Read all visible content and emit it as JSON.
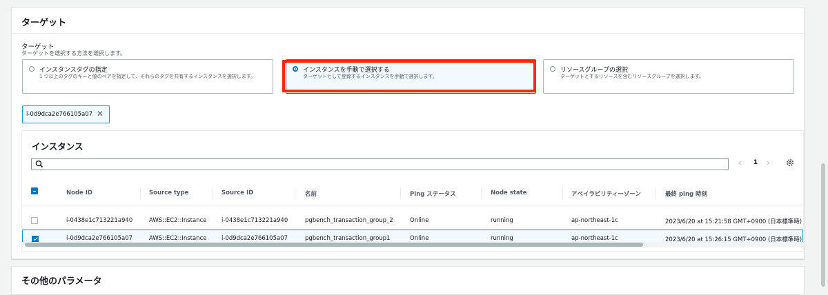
{
  "target_panel": {
    "title": "ターゲット",
    "field_label": "ターゲット",
    "field_desc": "ターゲットを選択する方法を選択します。",
    "options": [
      {
        "title": "インスタンスタグの指定",
        "desc": "1 つ以上のタグのキーと値のペアを指定して、それらのタグを共有するインスタンスを選択します。",
        "selected": false
      },
      {
        "title": "インスタンスを手動で選択する",
        "desc": "ターゲットとして登録するインスタンスを手動で選択します。",
        "selected": true
      },
      {
        "title": "リソースグループの選択",
        "desc": "ターゲットとするリソースを含むリソースグループを選択します。",
        "selected": false
      }
    ],
    "token": {
      "label": "i-0d9dca2e766105a07",
      "remove_icon": "close-icon"
    }
  },
  "instances": {
    "title": "インスタンス",
    "search_placeholder": "",
    "pager": {
      "current": "1",
      "prev_icon": "chevron-left-icon",
      "next_icon": "chevron-right-icon"
    },
    "columns": [
      "Node ID",
      "Source type",
      "Source ID",
      "名前",
      "Ping ステータス",
      "Node state",
      "アベイラビリティーゾーン",
      "最終 ping 時刻"
    ],
    "rows": [
      {
        "checked": false,
        "cells": [
          "i-0438e1c713221a940",
          "AWS::EC2::Instance",
          "i-0438e1c713221a940",
          "pgbench_transaction_group_2",
          "Online",
          "running",
          "ap-northeast-1c",
          "2023/6/20 at 15:21:58 GMT+0900 (日本標準時)"
        ]
      },
      {
        "checked": true,
        "cells": [
          "i-0d9dca2e766105a07",
          "AWS::EC2::Instance",
          "i-0d9dca2e766105a07",
          "pgbench_transaction_group1",
          "Online",
          "running",
          "ap-northeast-1c",
          "2023/6/20 at 15:26:15 GMT+0900 (日本標準時)"
        ]
      }
    ]
  },
  "other_panel": {
    "title": "その他のパラメータ"
  },
  "colors": {
    "accent": "#0073bb",
    "highlight": "#ff2a00",
    "selected_bg": "#f1faff"
  }
}
